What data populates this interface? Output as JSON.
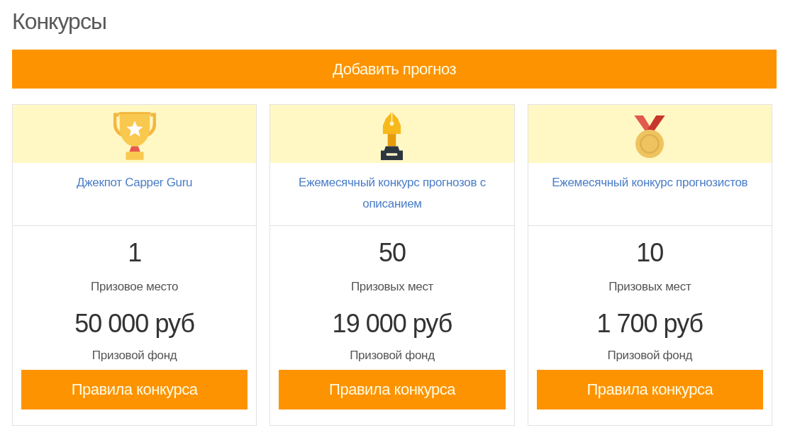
{
  "page_title": "Конкурсы",
  "add_forecast_button": "Добавить прогноз",
  "contests": [
    {
      "title": "Джекпот Capper Guru",
      "places_count": "1",
      "places_label": "Призовое место",
      "prize_fund": "50 000 руб",
      "prize_fund_label": "Призовой фонд",
      "rules_button": "Правила конкурса"
    },
    {
      "title": "Ежемесячный конкурс прогнозов с описанием",
      "places_count": "50",
      "places_label": "Призовых мест",
      "prize_fund": "19 000 руб",
      "prize_fund_label": "Призовой фонд",
      "rules_button": "Правила конкурса"
    },
    {
      "title": "Ежемесячный конкурс прогнозистов",
      "places_count": "10",
      "places_label": "Призовых мест",
      "prize_fund": "1 700 руб",
      "prize_fund_label": "Призовой фонд",
      "rules_button": "Правила конкурса"
    }
  ]
}
